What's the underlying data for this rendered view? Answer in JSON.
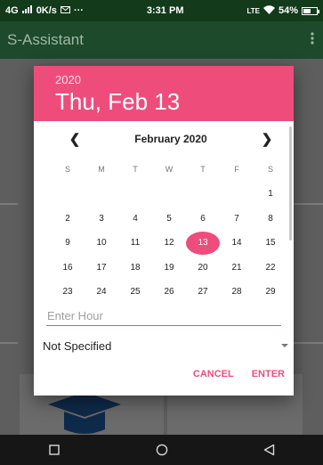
{
  "status_bar": {
    "network": "4G",
    "speed": "0K/s",
    "time": "3:31 PM",
    "volte": "LTE",
    "battery": "54%",
    "battery_level": 0.54
  },
  "app_bar": {
    "title": "S-Assistant",
    "menu_icon": "overflow-menu-icon"
  },
  "dialog": {
    "year": "2020",
    "date": "Thu, Feb 13",
    "month_label": "February 2020",
    "weekdays": [
      "S",
      "M",
      "T",
      "W",
      "T",
      "F",
      "S"
    ],
    "days": [
      "",
      "",
      "",
      "",
      "",
      "",
      "1",
      "2",
      "3",
      "4",
      "5",
      "6",
      "7",
      "8",
      "9",
      "10",
      "11",
      "12",
      "13",
      "14",
      "15",
      "16",
      "17",
      "18",
      "19",
      "20",
      "21",
      "22",
      "23",
      "24",
      "25",
      "26",
      "27",
      "28",
      "29"
    ],
    "selected_day": "13",
    "hour_placeholder": "Enter Hour",
    "hour_value": "",
    "spinner_value": "Not Specified",
    "cancel_label": "CANCEL",
    "enter_label": "ENTER"
  },
  "accent_color": "#ee4d7c",
  "appbar_color": "#1d4a2a"
}
